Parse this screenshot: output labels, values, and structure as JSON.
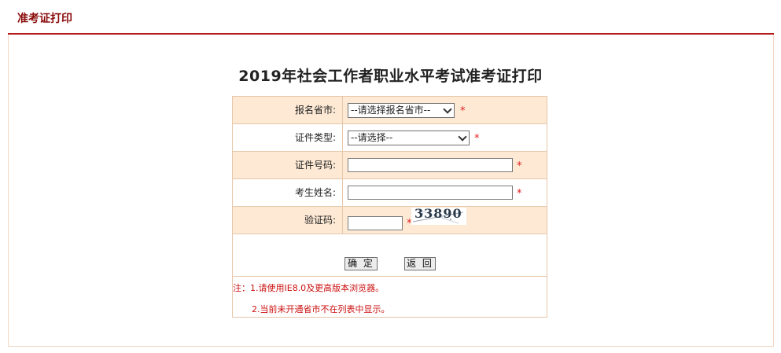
{
  "header": {
    "title": "准考证打印"
  },
  "form": {
    "title": "2019年社会工作者职业水平考试准考证打印",
    "fields": {
      "province": {
        "label": "报名省市:",
        "value": "--请选择报名省市--",
        "required": "*"
      },
      "id_type": {
        "label": "证件类型:",
        "value": "--请选择--",
        "required": "*"
      },
      "id_number": {
        "label": "证件号码:",
        "value": "",
        "required": "*"
      },
      "name": {
        "label": "考生姓名:",
        "value": "",
        "required": "*"
      },
      "captcha": {
        "label": "验证码:",
        "value": "",
        "required": "*",
        "image_text": "33890"
      }
    },
    "buttons": {
      "confirm": "确 定",
      "back": "返 回"
    },
    "notes": [
      "注：1.请使用IE8.0及更高版本浏览器。",
      "2.当前未开通省市不在列表中显示。"
    ]
  },
  "colors": {
    "accent": "#8b0b0b",
    "divider": "#b31a1a",
    "row_shade": "#fde9d4",
    "border": "#e7c7a9",
    "required": "#e02020"
  }
}
